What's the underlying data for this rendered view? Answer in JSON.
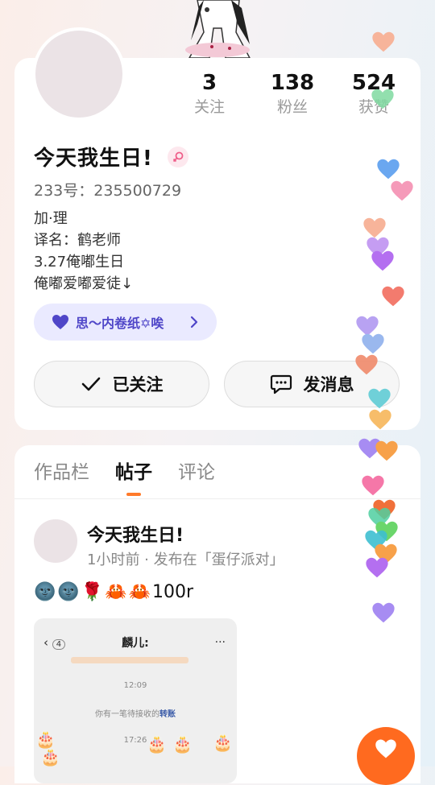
{
  "profile": {
    "stats": [
      {
        "num": "3",
        "label": "关注"
      },
      {
        "num": "138",
        "label": "粉丝"
      },
      {
        "num": "524",
        "label": "获赞"
      }
    ],
    "name": "今天我生日!",
    "uid": "233号：235500729",
    "bio": [
      "加·理",
      "译名：鹤老师",
      "3.27俺嘟生日",
      "俺嘟爱嘟爱徒↓"
    ],
    "tag": "思～内卷纸✡唉",
    "follow_label": "已关注",
    "message_label": "发消息"
  },
  "tabs": [
    "作品栏",
    "帖子",
    "评论"
  ],
  "active_tab": "帖子",
  "post": {
    "title": "今天我生日!",
    "meta": "1小时前 · 发布在「蛋仔派对」",
    "text": "100r",
    "emojis": [
      "🌚",
      "🌚",
      "🌹",
      "🦀",
      "🦀"
    ],
    "image": {
      "chat_name": "麟儿:",
      "badge": "4",
      "time1": "12:09",
      "transfer_prefix": "你有一笔待接收的",
      "transfer_link": "转账",
      "time2": "17:26"
    }
  },
  "colors": {
    "accent": "#ff6a1f",
    "tag_text": "#4f46c8",
    "tag_bg": "#eaeaff"
  }
}
